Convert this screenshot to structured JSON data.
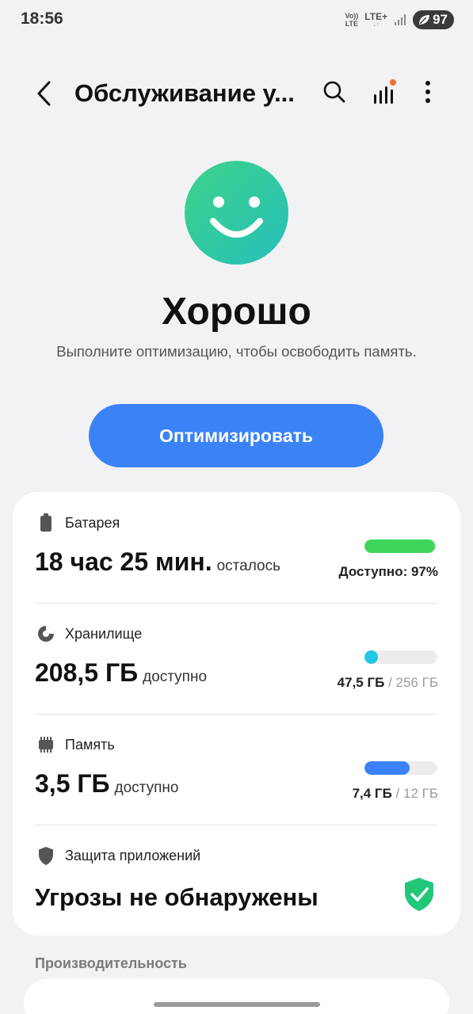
{
  "status_bar": {
    "time": "18:56",
    "volte_line1": "Vo))",
    "volte_line2": "LTE",
    "network": "LTE+",
    "network_arrows": "↓↑",
    "battery_level": "97"
  },
  "app_bar": {
    "title": "Обслуживание у...",
    "icons": [
      "back-icon",
      "search-icon",
      "stats-icon",
      "more-icon"
    ]
  },
  "hero": {
    "status": "Хорошо",
    "subtitle": "Выполните оптимизацию, чтобы освободить память.",
    "optimize_label": "Оптимизировать"
  },
  "battery": {
    "label": "Батарея",
    "value": "18 час 25 мин.",
    "unit": "осталось",
    "caption": "Доступно: 97%",
    "level": 0.97,
    "color": "#3dd65a"
  },
  "storage": {
    "label": "Хранилище",
    "value": "208,5 ГБ",
    "unit": "доступно",
    "used": "47,5 ГБ",
    "separator": "/",
    "total": "256 ГБ",
    "level": 0.186,
    "color": "#22c7e6"
  },
  "memory": {
    "label": "Память",
    "value": "3,5 ГБ",
    "unit": "доступно",
    "used": "7,4 ГБ",
    "separator": "/",
    "total": "12 ГБ",
    "level": 0.62,
    "color": "#3b82f6"
  },
  "protection": {
    "label": "Защита приложений",
    "value": "Угрозы не обнаружены",
    "color": "#22c77a"
  },
  "performance": {
    "header": "Производительность"
  }
}
